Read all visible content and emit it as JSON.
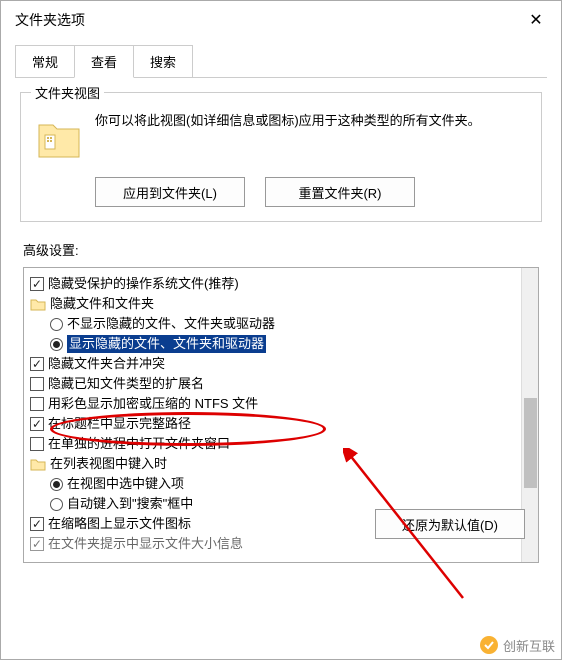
{
  "title": "文件夹选项",
  "tabs": {
    "general": "常规",
    "view": "查看",
    "search": "搜索"
  },
  "folderView": {
    "groupTitle": "文件夹视图",
    "description": "你可以将此视图(如详细信息或图标)应用于这种类型的所有文件夹。",
    "applyBtn": "应用到文件夹(L)",
    "resetBtn": "重置文件夹(R)"
  },
  "advancedLabel": "高级设置:",
  "tree": {
    "hideProtected": "隐藏受保护的操作系统文件(推荐)",
    "hiddenGroup": "隐藏文件和文件夹",
    "dontShowHidden": "不显示隐藏的文件、文件夹或驱动器",
    "showHidden": "显示隐藏的文件、文件夹和驱动器",
    "mergeConflict": "隐藏文件夹合并冲突",
    "hideExtensions": "隐藏已知文件类型的扩展名",
    "colorEncrypted": "用彩色显示加密或压缩的 NTFS 文件",
    "fullPath": "在标题栏中显示完整路径",
    "separateProcess": "在单独的进程中打开文件夹窗口",
    "listTypingGroup": "在列表视图中键入时",
    "typingSelect": "在视图中选中键入项",
    "typingSearch": "自动键入到\"搜索\"框中",
    "thumbnailIcons": "在缩略图上显示文件图标",
    "truncated": "在文件夹提示中显示文件大小信息"
  },
  "restoreBtn": "还原为默认值(D)",
  "watermark": "创新互联"
}
